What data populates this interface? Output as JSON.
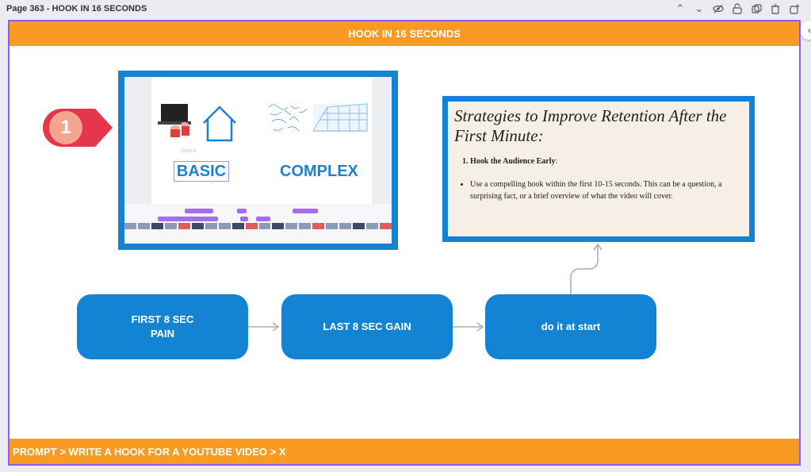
{
  "topbar": {
    "page_label": "Page 363 - HOOK IN 16 SECONDS",
    "tools": [
      "chevron-up-icon",
      "chevron-down-icon",
      "eye-off-icon",
      "lock-icon",
      "duplicate-icon",
      "trash-icon",
      "add-page-icon"
    ]
  },
  "canvas": {
    "header": "HOOK IN 16 SECONDS",
    "footer": "PROMPT > WRITE A HOOK FOR A YOUTUBE VIDEO > X",
    "badge_number": "1",
    "screenshot": {
      "left_word": "BASIC",
      "right_word": "COMPLEX"
    },
    "article": {
      "heading": "Strategies to Improve Retention After the First Minute:",
      "list_item": "Hook the Audience Early",
      "list_item_suffix": ":",
      "bullet": "Use a compelling hook within the first 10-15 seconds. This can be a question, a surprising fact, or a brief overview of what the video will cover."
    },
    "flow": [
      {
        "line1": "FIRST 8 SEC",
        "line2": "PAIN"
      },
      {
        "line1": "LAST 8 SEC GAIN"
      },
      {
        "line1": "do it at start"
      }
    ]
  },
  "colors": {
    "accent_orange": "#f99b22",
    "accent_blue": "#1384d4",
    "selection_purple": "#8b5cf6",
    "badge_red": "#e5364b"
  }
}
